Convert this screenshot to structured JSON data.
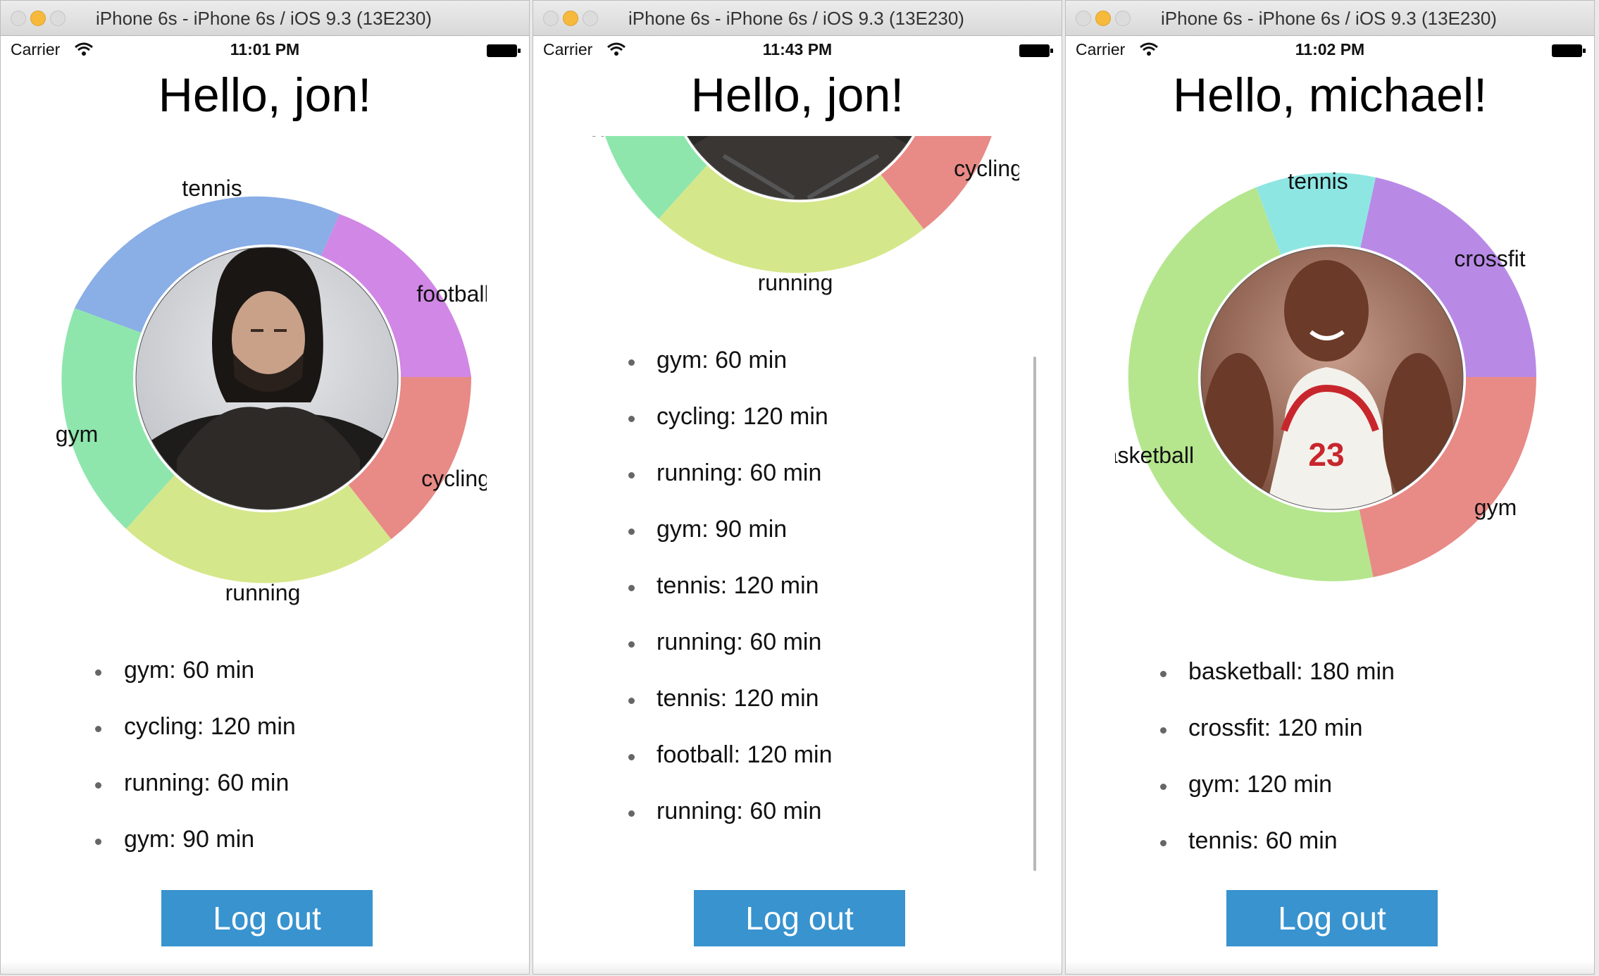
{
  "colors": {
    "tennis": "#8aaee6",
    "football": "#d187e6",
    "cycling": "#e88a86",
    "running": "#d5e78b",
    "gym": "#8ee6ad",
    "crossfit": "#b88ae6",
    "basketball": "#b5e68e",
    "tennis_alt": "#8ee6e3",
    "button": "#3893cf"
  },
  "windows": [
    {
      "title": "iPhone 6s - iPhone 6s / iOS 9.3 (13E230)",
      "carrier": "Carrier",
      "time": "11:01 PM",
      "greeting": "Hello, jon!",
      "chart_labels": {
        "tennis": "tennis",
        "football": "football",
        "gym": "gym",
        "cycling": "cycling",
        "running": "running"
      },
      "activities": [
        "gym: 60 min",
        "cycling: 120 min",
        "running: 60 min",
        "gym: 90 min"
      ],
      "logout_label": "Log out"
    },
    {
      "title": "iPhone 6s - iPhone 6s / iOS 9.3 (13E230)",
      "carrier": "Carrier",
      "time": "11:43 PM",
      "greeting": "Hello, jon!",
      "chart_labels": {
        "gym": "gym",
        "cycling": "cycling",
        "running": "running"
      },
      "activities": [
        "gym: 60 min",
        "cycling: 120 min",
        "running: 60 min",
        "gym: 90 min",
        "tennis: 120 min",
        "running: 60 min",
        "tennis: 120 min",
        "football: 120 min",
        "running: 60 min"
      ],
      "logout_label": "Log out"
    },
    {
      "title": "iPhone 6s - iPhone 6s / iOS 9.3 (13E230)",
      "carrier": "Carrier",
      "time": "11:02 PM",
      "greeting": "Hello, michael!",
      "chart_labels": {
        "tennis": "tennis",
        "crossfit": "crossfit",
        "basketball": "basketball",
        "gym": "gym"
      },
      "activities": [
        "basketball: 180 min",
        "crossfit: 120 min",
        "gym: 120 min",
        "tennis: 60 min"
      ],
      "logout_label": "Log out"
    }
  ]
}
